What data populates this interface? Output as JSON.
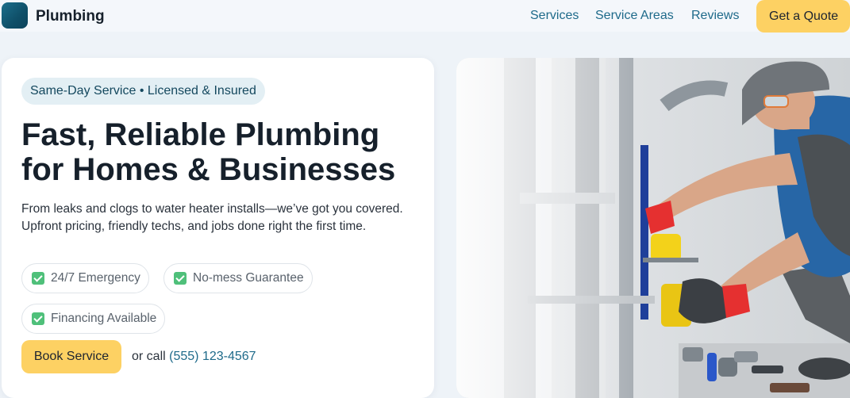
{
  "header": {
    "brand": "Plumbing",
    "nav": [
      "Services",
      "Service Areas",
      "Reviews"
    ],
    "cta": "Get a Quote"
  },
  "hero": {
    "badge": "Same-Day Service • Licensed & Insured",
    "headline_1": "Fast, Reliable Plumbing",
    "headline_2": "for Homes & Businesses",
    "description": "From leaks and clogs to water heater installs—we’ve got you covered. Upfront pricing, friendly techs, and jobs done right the first time.",
    "features": [
      "24/7 Emergency",
      "No-mess Guarantee",
      "Financing Available"
    ],
    "primary_button": "Book Service",
    "call_prefix": "or call",
    "phone": "(555) 123-4567"
  },
  "colors": {
    "accent": "#fdd163",
    "brand": "#1e6a8a",
    "check": "#4fc07a",
    "background": "#eef3f8"
  }
}
